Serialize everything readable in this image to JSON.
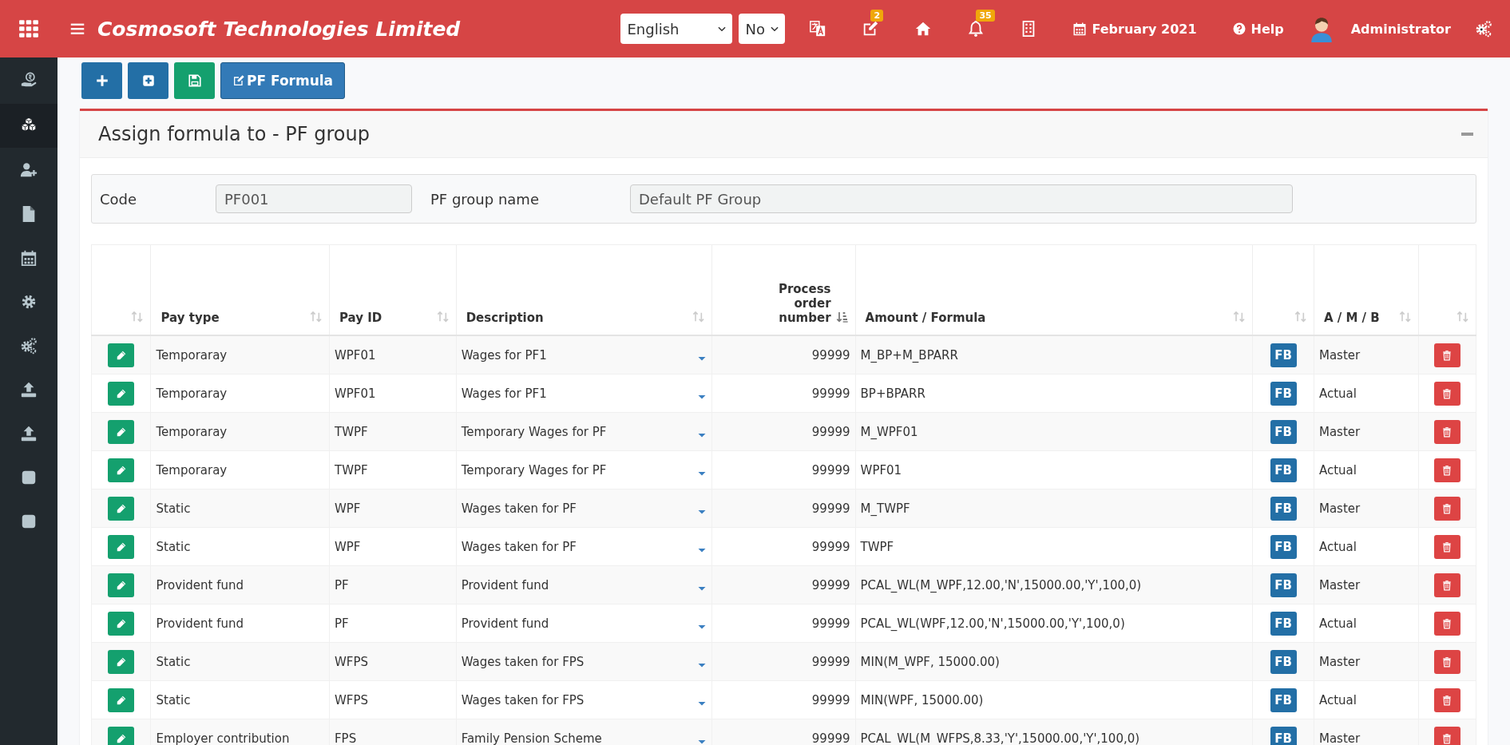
{
  "header": {
    "title": "Cosmosoft Technologies Limited",
    "language": "English",
    "second_select": "No",
    "badges": {
      "tasks": "2",
      "notifications": "35"
    },
    "period": "February 2021",
    "help": "Help",
    "user": "Administrator"
  },
  "sidebar": {
    "items": [
      {
        "selected": false
      },
      {
        "selected": true
      },
      {
        "selected": false
      },
      {
        "selected": false
      },
      {
        "selected": false
      },
      {
        "selected": false
      },
      {
        "selected": false
      },
      {
        "selected": false
      },
      {
        "selected": false
      },
      {
        "selected": false
      },
      {
        "selected": false
      }
    ]
  },
  "toolbar": [
    {
      "kind": "add"
    },
    {
      "kind": "add-box"
    },
    {
      "kind": "save"
    },
    {
      "kind": "formula",
      "label": "PF Formula"
    }
  ],
  "panel": {
    "title": "Assign formula to - PF group",
    "form": [
      {
        "label": "Code",
        "value": "PF001"
      },
      {
        "label": "PF group name",
        "value": "Default PF Group"
      }
    ]
  },
  "table": {
    "columns": [
      {
        "sorted": false
      },
      {
        "label": "Pay type",
        "sorted": false
      },
      {
        "label": "Pay ID",
        "sorted": false
      },
      {
        "label": "Description",
        "sorted": false
      },
      {
        "label": "Process order number",
        "sorted": true
      },
      {
        "label": "Amount / Formula",
        "sorted": false
      },
      {
        "sorted": false
      },
      {
        "label": "A / M / B",
        "sorted": false
      },
      {
        "sorted": false
      }
    ],
    "rows": [
      {
        "pay_type": "Temporaray",
        "pay_id": "WPF01",
        "description": "Wages for PF1",
        "order": "99999",
        "formula": "M_BP+M_BPARR",
        "fb": "FB",
        "amb": "Master"
      },
      {
        "pay_type": "Temporaray",
        "pay_id": "WPF01",
        "description": "Wages for PF1",
        "order": "99999",
        "formula": "BP+BPARR",
        "fb": "FB",
        "amb": "Actual"
      },
      {
        "pay_type": "Temporaray",
        "pay_id": "TWPF",
        "description": "Temporary Wages for PF",
        "order": "99999",
        "formula": "M_WPF01",
        "fb": "FB",
        "amb": "Master"
      },
      {
        "pay_type": "Temporaray",
        "pay_id": "TWPF",
        "description": "Temporary Wages for PF",
        "order": "99999",
        "formula": "WPF01",
        "fb": "FB",
        "amb": "Actual"
      },
      {
        "pay_type": "Static",
        "pay_id": "WPF",
        "description": "Wages taken for PF",
        "order": "99999",
        "formula": "M_TWPF",
        "fb": "FB",
        "amb": "Master"
      },
      {
        "pay_type": "Static",
        "pay_id": "WPF",
        "description": "Wages taken for PF",
        "order": "99999",
        "formula": "TWPF",
        "fb": "FB",
        "amb": "Actual"
      },
      {
        "pay_type": "Provident fund",
        "pay_id": "PF",
        "description": "Provident fund",
        "order": "99999",
        "formula": "PCAL_WL(M_WPF,12.00,'N',15000.00,'Y',100,0)",
        "fb": "FB",
        "amb": "Master"
      },
      {
        "pay_type": "Provident fund",
        "pay_id": "PF",
        "description": "Provident fund",
        "order": "99999",
        "formula": "PCAL_WL(WPF,12.00,'N',15000.00,'Y',100,0)",
        "fb": "FB",
        "amb": "Actual"
      },
      {
        "pay_type": "Static",
        "pay_id": "WFPS",
        "description": "Wages taken for FPS",
        "order": "99999",
        "formula": "MIN(M_WPF, 15000.00)",
        "fb": "FB",
        "amb": "Master"
      },
      {
        "pay_type": "Static",
        "pay_id": "WFPS",
        "description": "Wages taken for FPS",
        "order": "99999",
        "formula": "MIN(WPF, 15000.00)",
        "fb": "FB",
        "amb": "Actual"
      },
      {
        "pay_type": "Employer contribution",
        "pay_id": "FPS",
        "description": "Family Pension Scheme",
        "order": "99999",
        "formula": "PCAL_WL(M_WFPS,8.33,'Y',15000.00,'Y',100,0)",
        "fb": "FB",
        "amb": "Master"
      }
    ]
  }
}
